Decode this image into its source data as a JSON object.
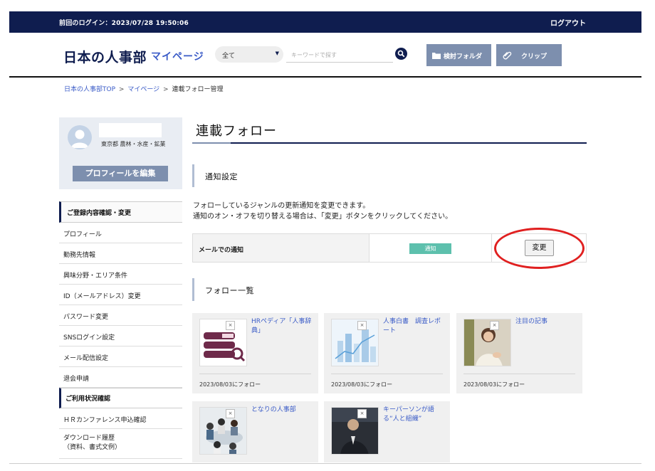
{
  "topbar": {
    "last_login": "前回のログイン：2023/07/28 19:50:06",
    "logout": "ログアウト"
  },
  "header": {
    "logo": "日本の人事部",
    "mypage": "マイページ",
    "category_select": "全て",
    "search_placeholder": "キーワードで探す",
    "folder_button": "検討フォルダ",
    "clip_button": "クリップ"
  },
  "breadcrumb": {
    "home": "日本の人事部TOP",
    "sep": ">",
    "mypage": "マイページ",
    "current": "連載フォロー管理"
  },
  "profile": {
    "location": "東京都 農林・水産・鉱業",
    "edit_button": "プロフィールを編集"
  },
  "sidemenu": {
    "section1": "ご登録内容確認・変更",
    "items1": [
      "プロフィール",
      "勤務先情報",
      "興味分野・エリア条件",
      "ID（メールアドレス）変更",
      "パスワード変更",
      "SNSログイン設定",
      "メール配信設定",
      "退会申請"
    ],
    "section2": "ご利用状況確認",
    "item_hr_conf": "ＨＲカンファレンス申込確認",
    "item_download_l1": "ダウンロード履歴",
    "item_download_l2": "（資料、書式文例）"
  },
  "main": {
    "title": "連載フォロー",
    "notify_heading": "通知設定",
    "desc_line1": "フォローしているジャンルの更新通知を変更できます。",
    "desc_line2": "通知のオン・オフを切り替える場合は、「変更」ボタンをクリックしてください。",
    "mail_notify_label": "メールでの通知",
    "notify_status": "通知",
    "change_button": "変更",
    "follow_heading": "フォロー一覧"
  },
  "follow_cards": [
    {
      "title": "HRペディア「人事辞典」",
      "date": "2023/08/03にフォロー",
      "thumb_icon": "books-magnifier-icon"
    },
    {
      "title": "人事白書　調査レポート",
      "date": "2023/08/03にフォロー",
      "thumb_icon": "city-chart-icon"
    },
    {
      "title": "注目の記事",
      "date": "2023/08/03にフォロー",
      "thumb_icon": "woman-photo-icon"
    },
    {
      "title": "となりの人事部",
      "date": "",
      "thumb_icon": "meeting-photo-icon"
    },
    {
      "title": "キーパーソンが語る“人と組織”",
      "date": "",
      "thumb_icon": "speaker-photo-icon"
    }
  ],
  "close_glyph": "×",
  "colors": {
    "navy": "#0f1d4f",
    "accent_blue": "#3a5bc7",
    "button_slate": "#7d8fae",
    "notify_green": "#5dc0ad",
    "highlight_red": "#e02020"
  }
}
